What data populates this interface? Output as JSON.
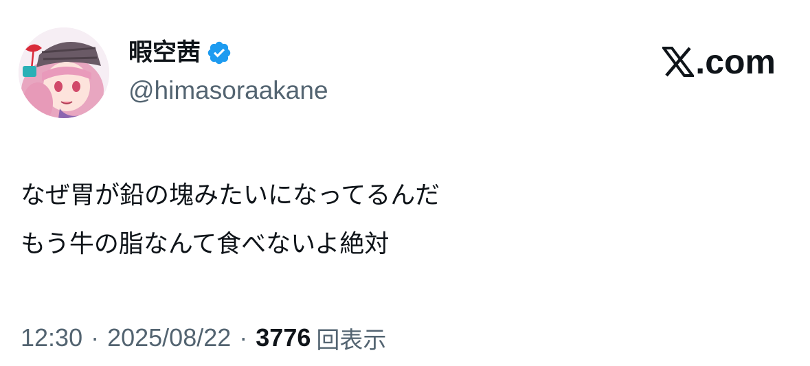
{
  "author": {
    "display_name": "暇空茜",
    "handle": "@himasoraakane",
    "verified": true,
    "avatar_icon": "avatar-anime-girl-pink-hair-beret"
  },
  "brand": {
    "logo_icon": "x-logo-icon",
    "text": ".com"
  },
  "tweet": {
    "lines": [
      "なぜ胃が鉛の塊みたいになってるんだ",
      "もう牛の脂なんて食べないよ絶対"
    ]
  },
  "meta": {
    "time": "12:30",
    "separator": "·",
    "date": "2025/08/22",
    "views_count": "3776",
    "views_label": "回表示"
  },
  "colors": {
    "text_primary": "#0f1419",
    "text_secondary": "#536471",
    "verified_blue": "#1d9bf0",
    "background": "#ffffff"
  }
}
